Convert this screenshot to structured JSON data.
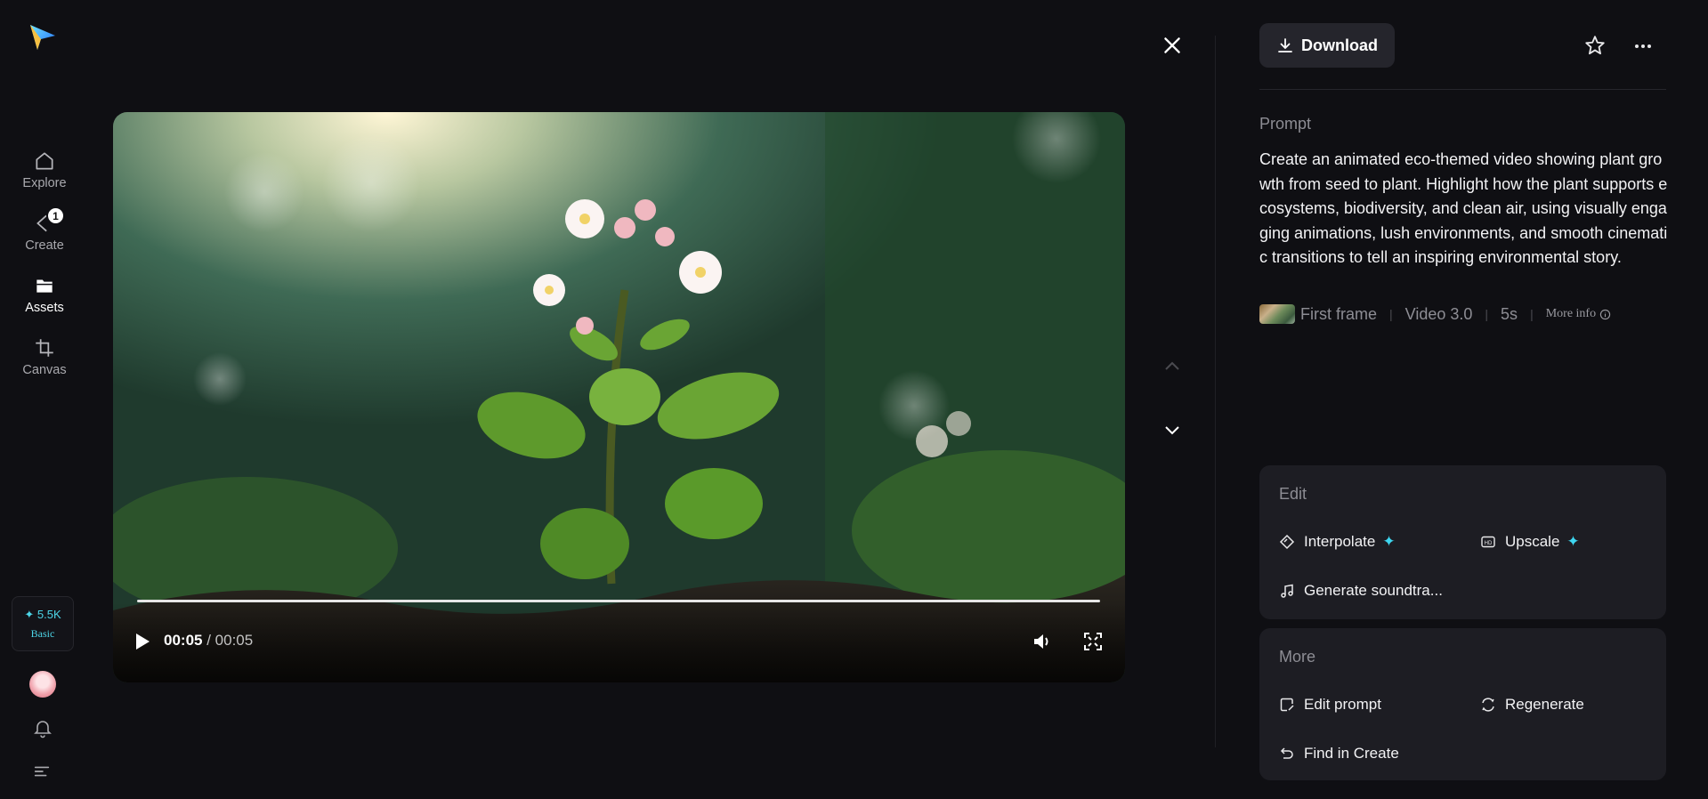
{
  "sidebar": {
    "items": [
      {
        "label": "Explore",
        "icon": "home-icon"
      },
      {
        "label": "Create",
        "icon": "create-icon",
        "badge": "1"
      },
      {
        "label": "Assets",
        "icon": "folder-icon"
      },
      {
        "label": "Canvas",
        "icon": "canvas-icon"
      }
    ],
    "credits": {
      "amount": "✦ 5.5K",
      "plan": "Basic"
    }
  },
  "video": {
    "current_time": "00:05",
    "duration": "/ 00:05",
    "progress": 1.0
  },
  "toolbar": {
    "download_label": "Download"
  },
  "prompt": {
    "label": "Prompt",
    "text": "Create an animated eco-themed video showing plant growth from seed to plant. Highlight how the plant supports ecosystems, biodiversity, and clean air, using visually engaging animations, lush environments, and smooth cinematic transitions to tell an inspiring environmental story.",
    "meta": {
      "first_frame": "First frame",
      "model": "Video 3.0",
      "duration": "5s",
      "more_info": "More info"
    }
  },
  "edit": {
    "title": "Edit",
    "interpolate": "Interpolate",
    "upscale": "Upscale",
    "soundtrack": "Generate soundtra..."
  },
  "more": {
    "title": "More",
    "edit_prompt": "Edit prompt",
    "regenerate": "Regenerate",
    "find_in_create": "Find in Create"
  },
  "colors": {
    "accent": "#3ed6f0",
    "background": "#0f0f13",
    "card": "#1d1d23"
  }
}
